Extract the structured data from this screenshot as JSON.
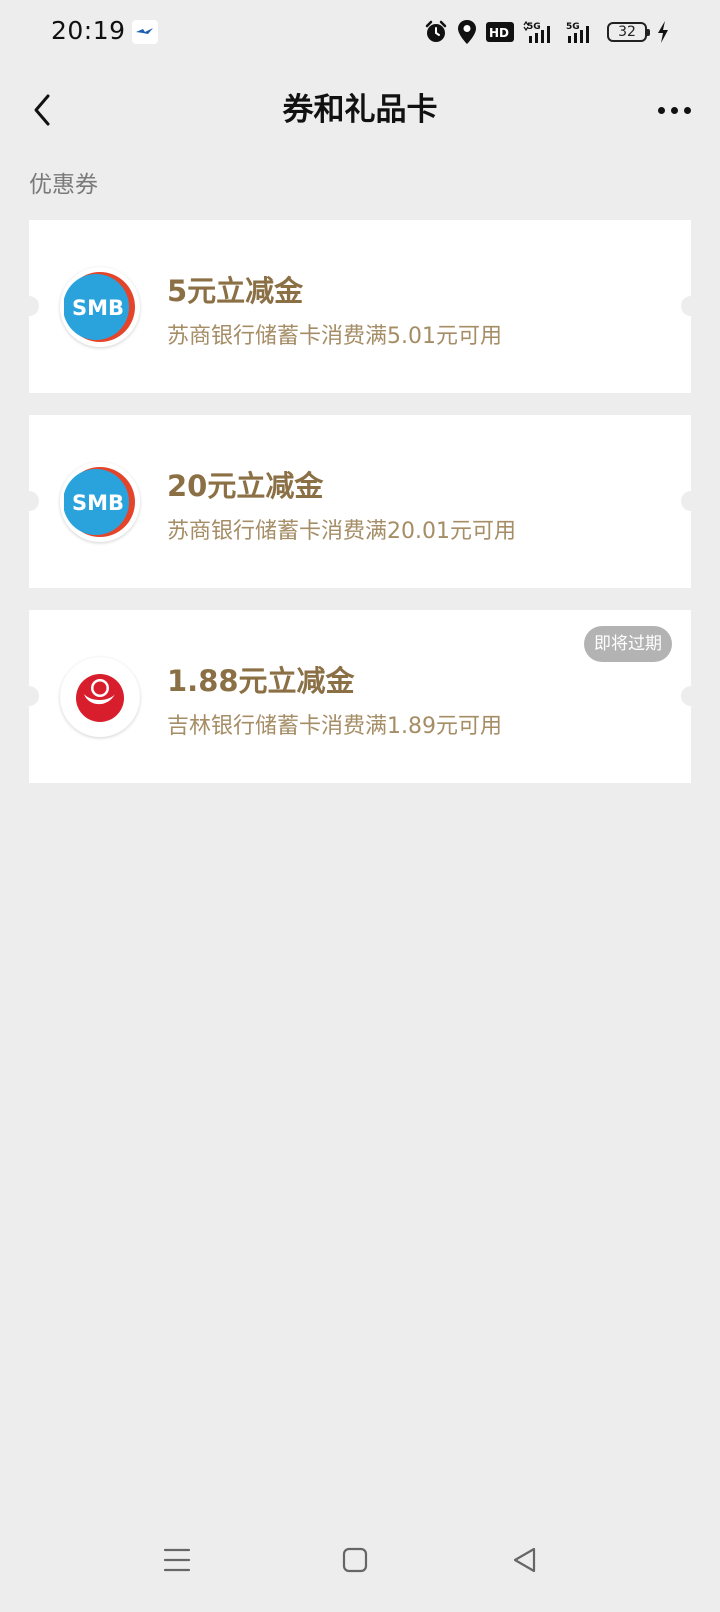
{
  "status_bar": {
    "time": "20:19",
    "battery": "32",
    "network_1": "5G",
    "network_2": "5G",
    "hd_label": "HD"
  },
  "navbar": {
    "title": "券和礼品卡",
    "back_icon": "chevron-left-icon",
    "more_icon": "more-horizontal-icon"
  },
  "section": {
    "label": "优惠券"
  },
  "coupons": [
    {
      "title": "5元立减金",
      "desc": "苏商银行储蓄卡消费满5.01元可用",
      "logo": "smb-logo",
      "logo_text": "SMB",
      "badge": ""
    },
    {
      "title": "20元立减金",
      "desc": "苏商银行储蓄卡消费满20.01元可用",
      "logo": "smb-logo",
      "logo_text": "SMB",
      "badge": ""
    },
    {
      "title": "1.88元立减金",
      "desc": "吉林银行储蓄卡消费满1.89元可用",
      "logo": "jilin-bank-logo",
      "logo_text": "",
      "badge": "即将过期"
    }
  ],
  "colors": {
    "background": "#ededed",
    "card": "#ffffff",
    "coupon_title": "#8b6f45",
    "coupon_desc": "#a58d66",
    "badge_bg": "#b3b3b3",
    "smb_blue": "#2aa3dc",
    "smb_red": "#e4442a",
    "jilin_red": "#d81e2c"
  }
}
